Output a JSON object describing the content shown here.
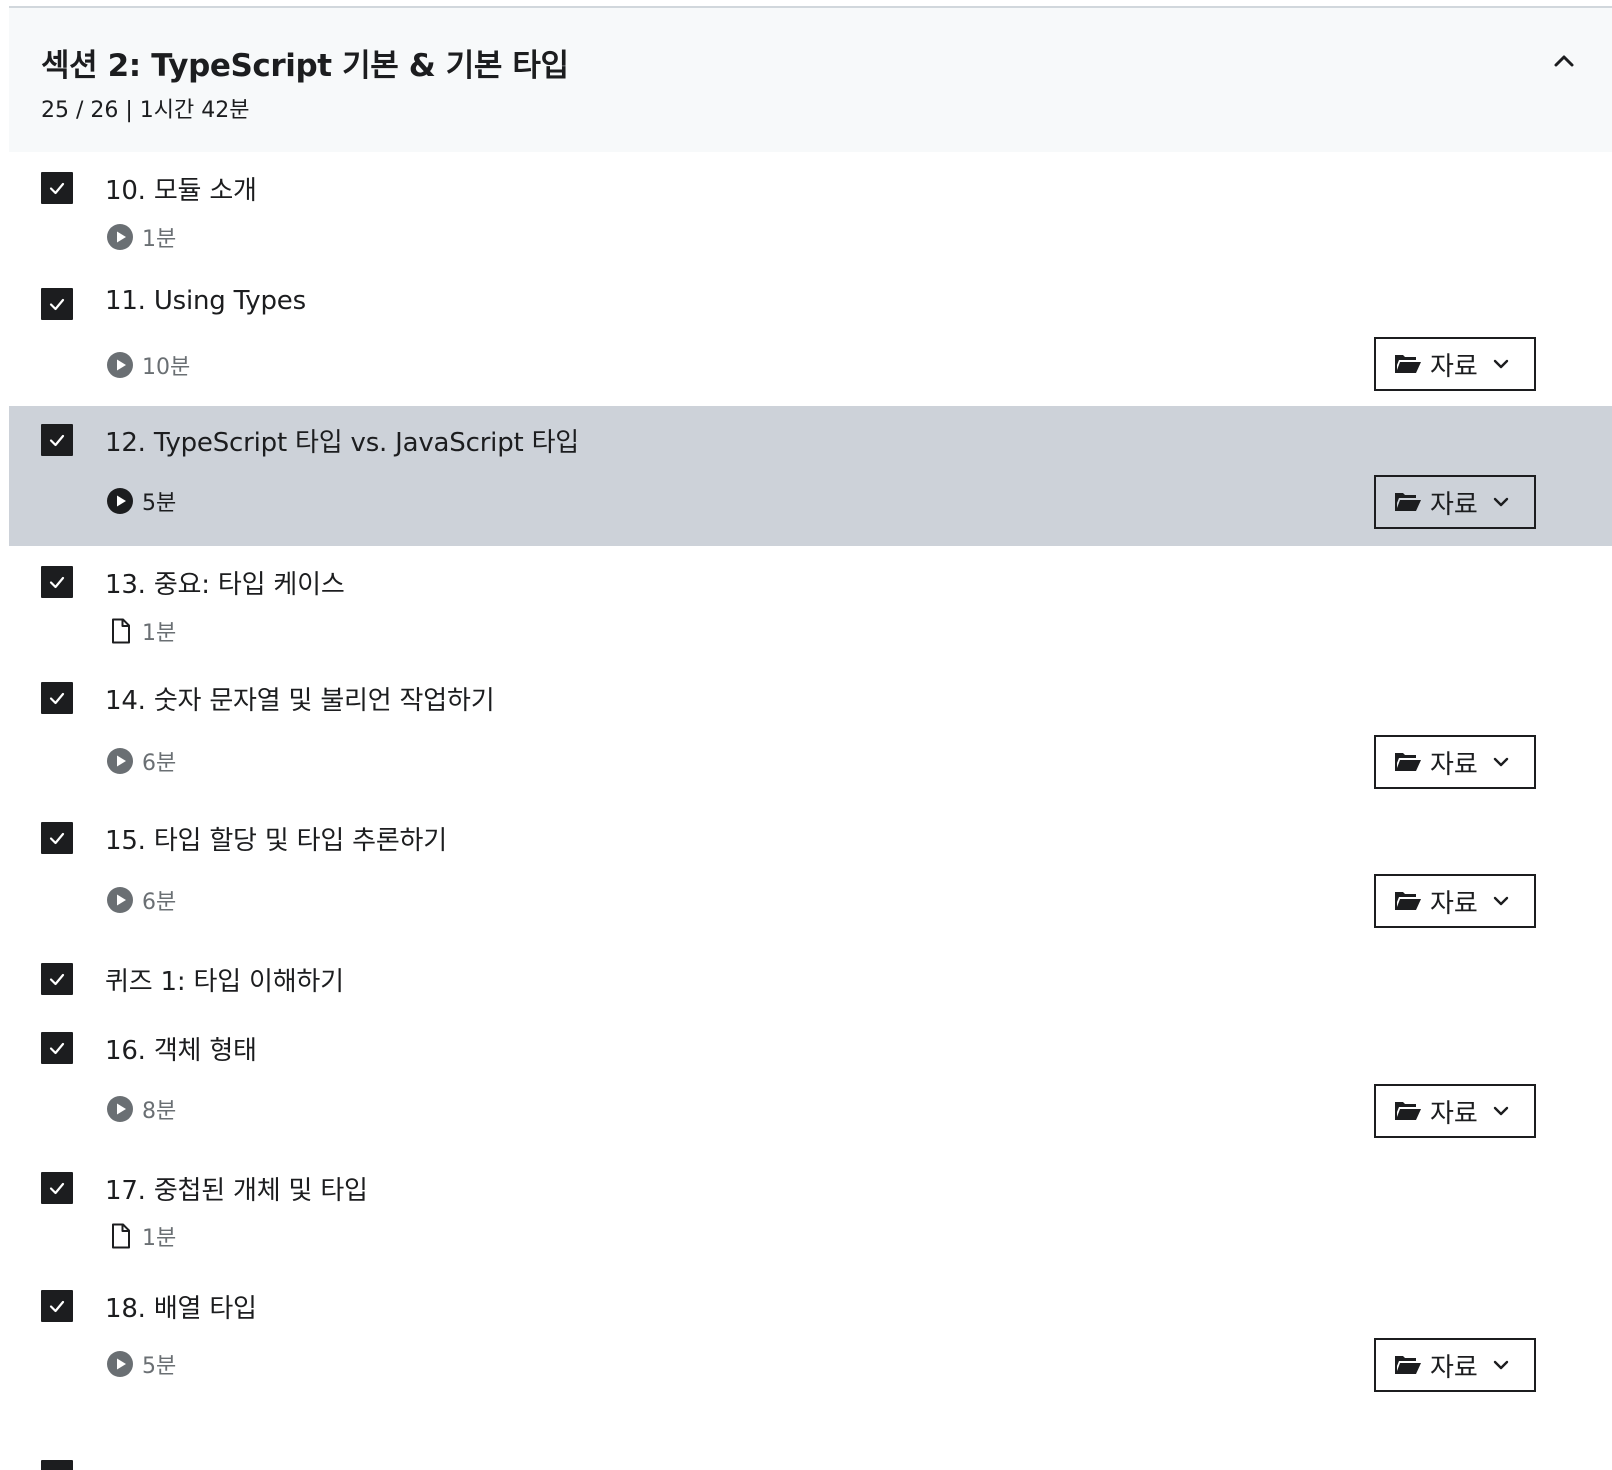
{
  "section": {
    "title": "섹션 2: TypeScript 기본 & 기본 타입",
    "meta": "25 / 26 | 1시간 42분"
  },
  "resources_label": "자료",
  "colors": {
    "active_row": "#cdd2d9",
    "header_bg": "#f7f9fa",
    "checkbox": "#1c1d1f",
    "muted_text": "#6a6f73"
  },
  "items": [
    {
      "title": "10. 모듈 소개",
      "duration": "1분",
      "icon": "play-circle-icon",
      "checked": true,
      "has_resources": false
    },
    {
      "title": "11. Using Types",
      "duration": "10분",
      "icon": "play-circle-icon",
      "checked": true,
      "has_resources": true
    },
    {
      "title": "12. TypeScript 타입 vs. JavaScript 타입",
      "duration": "5분",
      "icon": "play-circle-icon",
      "checked": true,
      "has_resources": true,
      "active": true
    },
    {
      "title": "13. 중요: 타입 케이스",
      "duration": "1분",
      "icon": "document-icon",
      "checked": true,
      "has_resources": false
    },
    {
      "title": "14. 숫자 문자열 및 불리언 작업하기",
      "duration": "6분",
      "icon": "play-circle-icon",
      "checked": true,
      "has_resources": true
    },
    {
      "title": "15. 타입 할당 및 타입 추론하기",
      "duration": "6분",
      "icon": "play-circle-icon",
      "checked": true,
      "has_resources": true
    },
    {
      "title": "퀴즈 1: 타입 이해하기",
      "checked": true,
      "has_resources": false
    },
    {
      "title": "16. 객체 형태",
      "duration": "8분",
      "icon": "play-circle-icon",
      "checked": true,
      "has_resources": true
    },
    {
      "title": "17. 중첩된 개체 및 타입",
      "duration": "1분",
      "icon": "document-icon",
      "checked": true,
      "has_resources": false
    },
    {
      "title": "18. 배열 타입",
      "duration": "5분",
      "icon": "play-circle-icon",
      "checked": true,
      "has_resources": true
    }
  ]
}
